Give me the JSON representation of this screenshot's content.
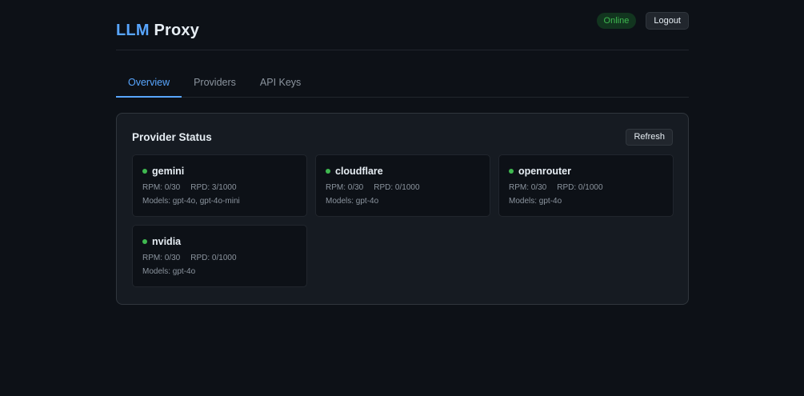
{
  "header": {
    "brand_accent": "LLM",
    "brand_rest": "Proxy",
    "status": "Online",
    "logout_label": "Logout"
  },
  "tabs": [
    {
      "label": "Overview",
      "active": true
    },
    {
      "label": "Providers",
      "active": false
    },
    {
      "label": "API Keys",
      "active": false
    }
  ],
  "panel": {
    "title": "Provider Status",
    "refresh_label": "Refresh",
    "providers": [
      {
        "name": "gemini",
        "rpm": "RPM: 0/30",
        "rpd": "RPD: 3/1000",
        "models": "Models: gpt-4o, gpt-4o-mini"
      },
      {
        "name": "cloudflare",
        "rpm": "RPM: 0/30",
        "rpd": "RPD: 0/1000",
        "models": "Models: gpt-4o"
      },
      {
        "name": "openrouter",
        "rpm": "RPM: 0/30",
        "rpd": "RPD: 0/1000",
        "models": "Models: gpt-4o"
      },
      {
        "name": "nvidia",
        "rpm": "RPM: 0/30",
        "rpd": "RPD: 0/1000",
        "models": "Models: gpt-4o"
      }
    ]
  },
  "colors": {
    "accent": "#58a6ff",
    "online": "#3fb950",
    "background": "#0d1117",
    "panel": "#161b22"
  },
  "icons": {
    "status_dot": "status-dot-icon"
  }
}
